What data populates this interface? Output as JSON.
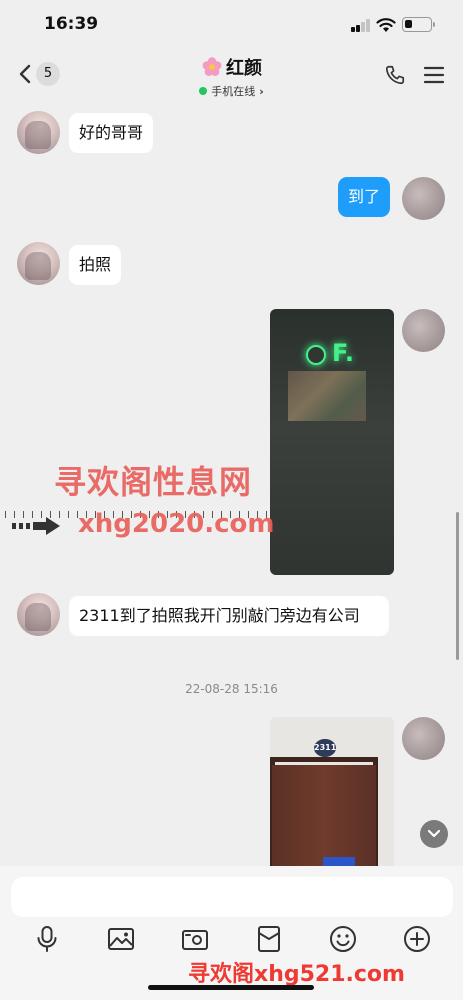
{
  "status_bar": {
    "time": "16:39"
  },
  "nav": {
    "unread_count": "5",
    "contact_name": "红颜",
    "presence": "手机在线",
    "presence_chevron": "›"
  },
  "messages": [
    {
      "side": "in",
      "text": "好的哥哥"
    },
    {
      "side": "out",
      "text": "到了"
    },
    {
      "side": "in",
      "text": "拍照"
    },
    {
      "side": "out",
      "type": "image",
      "sign_text": "F."
    },
    {
      "side": "in",
      "text": "2311到了拍照我开门别敲门旁边有公司"
    },
    {
      "type": "timestamp",
      "text": "22-08-28 15:16"
    },
    {
      "side": "out",
      "type": "image",
      "room_number": "2311"
    }
  ],
  "watermarks": {
    "site_name": "寻欢阁性息网",
    "site_url": "xhg2020.com",
    "bottom_url": "寻欢阁xhg521.com"
  },
  "composer": {
    "placeholder": ""
  },
  "toolbar": [
    "microphone-icon",
    "image-icon",
    "camera-icon",
    "red-packet-icon",
    "emoji-icon",
    "plus-icon"
  ],
  "colors": {
    "accent": "#1f9dfb",
    "online": "#22c55e",
    "watermark": "#e9605c"
  }
}
